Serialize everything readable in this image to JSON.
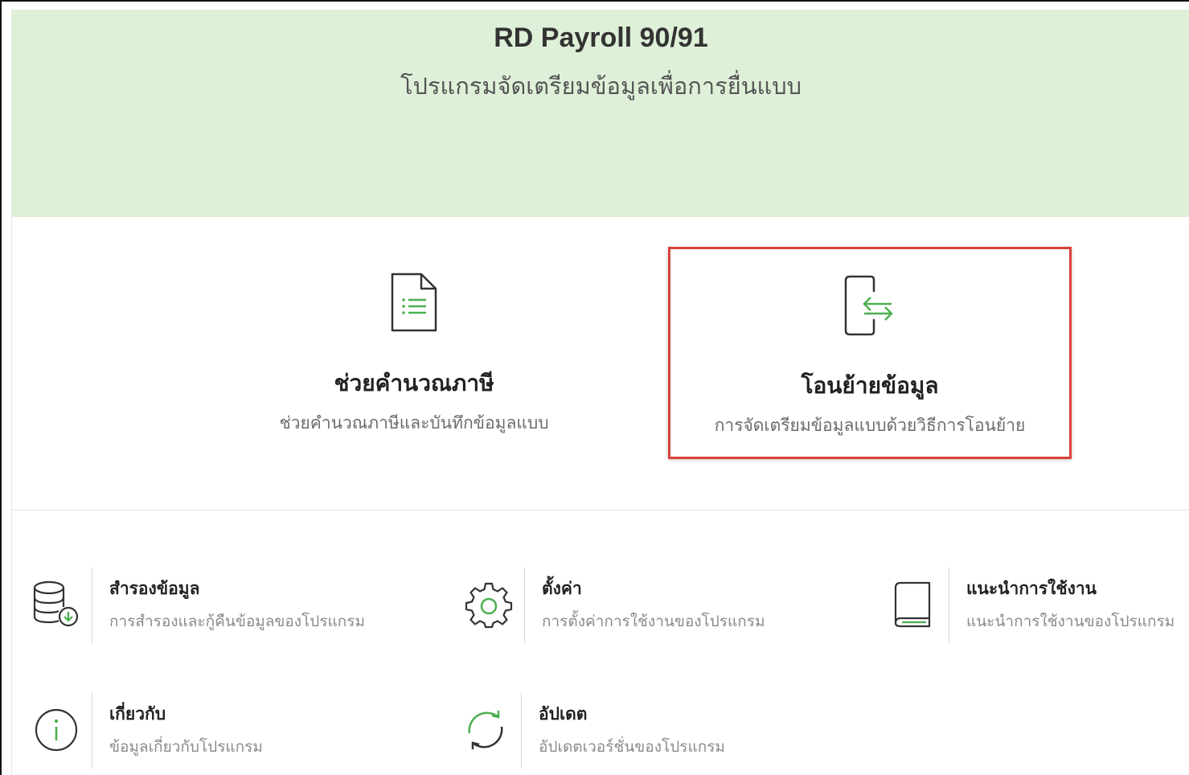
{
  "app": {
    "title": "RD Payroll 90/91",
    "subtitle": "โปรแกรมจัดเตรียมข้อมูลเพื่อการยื่นแบบ"
  },
  "main_actions": [
    {
      "title": "ช่วยคำนวณภาษี",
      "description": "ช่วยคำนวณภาษีและบันทึกข้อมูลแบบ",
      "icon": "document-list-icon"
    },
    {
      "title": "โอนย้ายข้อมูล",
      "description": "การจัดเตรียมข้อมูลแบบด้วยวิธีการโอนย้าย",
      "icon": "file-transfer-icon",
      "highlighted": true
    }
  ],
  "tools": [
    {
      "title": "สำรองข้อมูล",
      "description": "การสำรองและกู้คืนข้อมูลของโปรแกรม",
      "icon": "database-backup-icon"
    },
    {
      "title": "ตั้งค่า",
      "description": "การตั้งค่าการใช้งานของโปรแกรม",
      "icon": "gear-icon"
    },
    {
      "title": "แนะนำการใช้งาน",
      "description": "แนะนำการใช้งานของโปรแกรม",
      "icon": "book-icon"
    },
    {
      "title": "เกี่ยวกับ",
      "description": "ข้อมูลเกี่ยวกับโปรแกรม",
      "icon": "info-icon"
    },
    {
      "title": "อัปเดต",
      "description": "อัปเดตเวอร์ชั่นของโปรแกรม",
      "icon": "refresh-icon"
    }
  ],
  "colors": {
    "header_bg": "#dff0d9",
    "accent_green": "#4caf50",
    "highlight_red": "#d9433c"
  }
}
